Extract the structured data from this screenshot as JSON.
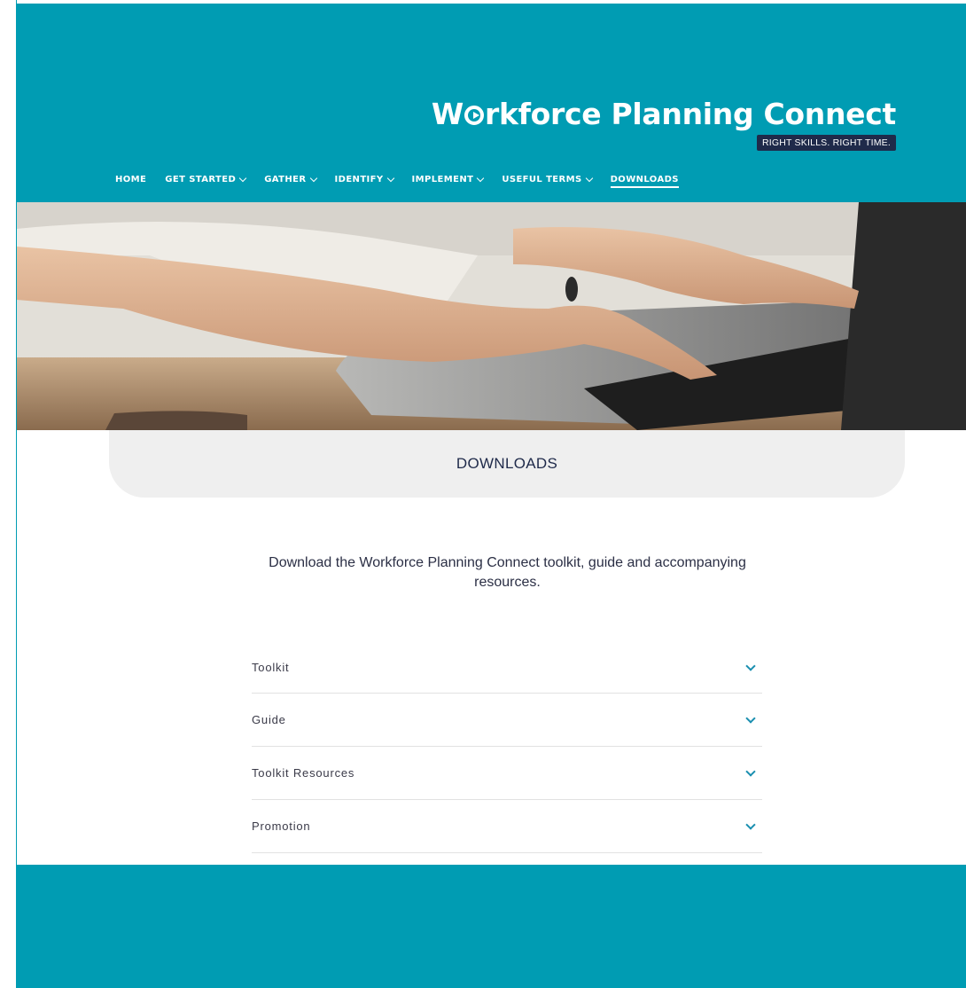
{
  "site": {
    "logo_title_pre": "W",
    "logo_title_post": "rkforce Planning Connect",
    "logo_tagline": "RIGHT SKILLS. RIGHT TIME."
  },
  "nav": {
    "items": [
      {
        "label": "HOME",
        "has_dropdown": false,
        "active": false
      },
      {
        "label": "GET STARTED",
        "has_dropdown": true,
        "active": false
      },
      {
        "label": "GATHER",
        "has_dropdown": true,
        "active": false
      },
      {
        "label": "IDENTIFY",
        "has_dropdown": true,
        "active": false
      },
      {
        "label": "IMPLEMENT",
        "has_dropdown": true,
        "active": false
      },
      {
        "label": "USEFUL TERMS",
        "has_dropdown": true,
        "active": false
      },
      {
        "label": "DOWNLOADS",
        "has_dropdown": false,
        "active": true
      }
    ]
  },
  "main": {
    "title": "DOWNLOADS",
    "intro": "Download the Workforce Planning Connect toolkit, guide and accompanying resources.",
    "accordion": [
      {
        "label": "Toolkit",
        "icon": "chevron-down-icon"
      },
      {
        "label": "Guide",
        "icon": "chevron-down-icon"
      },
      {
        "label": "Toolkit Resources",
        "icon": "chevron-down-icon"
      },
      {
        "label": "Promotion",
        "icon": "chevron-down-icon"
      }
    ]
  },
  "colors": {
    "brand_teal": "#009cb3",
    "navy": "#1f2a4a",
    "accent_chevron": "#1a8fb0",
    "panel_grey": "#efefef"
  }
}
